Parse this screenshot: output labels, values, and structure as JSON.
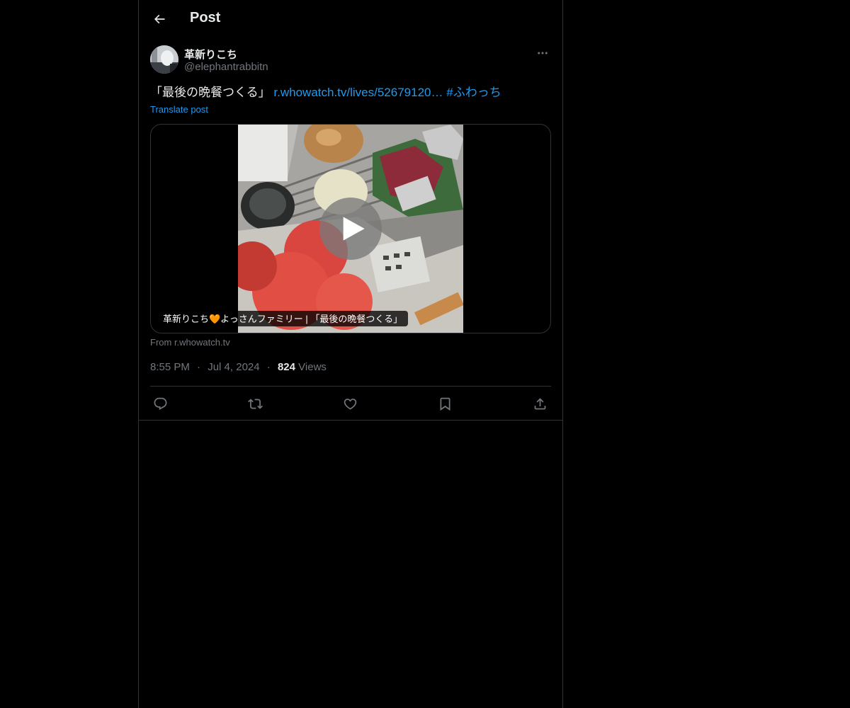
{
  "header": {
    "title": "Post"
  },
  "author": {
    "display_name": "革新りこち",
    "handle": "@elephantrabbitn"
  },
  "post": {
    "text": "「最後の晩餐つくる」",
    "link": "r.whowatch.tv/lives/52679120…",
    "hashtag": "#ふわっち",
    "translate_label": "Translate post"
  },
  "media": {
    "caption": "革新りこち🧡よっさんファミリー | 「最後の晩餐つくる」",
    "source": "From r.whowatch.tv"
  },
  "meta": {
    "time": "8:55 PM",
    "date": "Jul 4, 2024",
    "separator": "·",
    "views_count": "824",
    "views_label": "Views"
  },
  "actions": {
    "reply_icon": "reply-icon",
    "repost_icon": "repost-icon",
    "like_icon": "heart-icon",
    "bookmark_icon": "bookmark-icon",
    "share_icon": "share-icon"
  },
  "colors": {
    "background": "#000000",
    "text_primary": "#e7e9ea",
    "text_secondary": "#71767b",
    "accent": "#1d9bf0",
    "border": "#2f3336"
  }
}
